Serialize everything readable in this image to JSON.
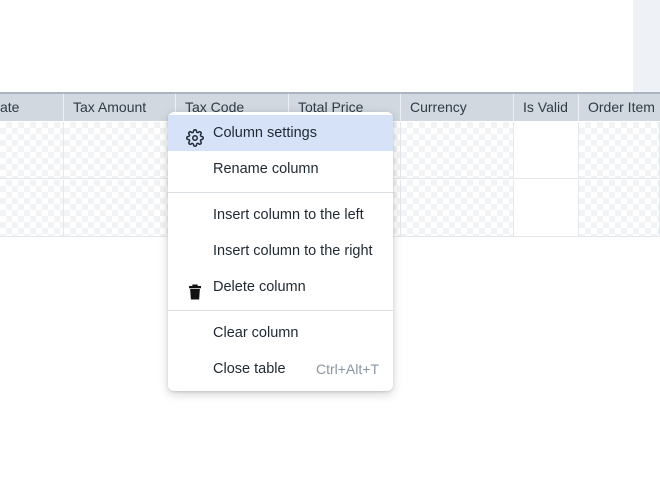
{
  "table": {
    "columns": [
      {
        "label": "ate"
      },
      {
        "label": "Tax Amount"
      },
      {
        "label": "Tax Code"
      },
      {
        "label": "Total Price"
      },
      {
        "label": "Currency"
      },
      {
        "label": "Is Valid"
      },
      {
        "label": "Order Item"
      }
    ]
  },
  "context_menu": {
    "items": [
      {
        "label": "Column settings",
        "icon": "gear-icon",
        "highlighted": true
      },
      {
        "label": "Rename column"
      },
      {
        "label": "Insert column to the left"
      },
      {
        "label": "Insert column to the right"
      },
      {
        "label": "Delete column",
        "icon": "trash-icon"
      },
      {
        "label": "Clear column"
      },
      {
        "label": "Close table",
        "shortcut": "Ctrl+Alt+T"
      }
    ]
  },
  "colors": {
    "header_bg": "#d1d8df",
    "menu_highlight": "#d6e2f8",
    "shortcut_text": "#8a96a3"
  }
}
